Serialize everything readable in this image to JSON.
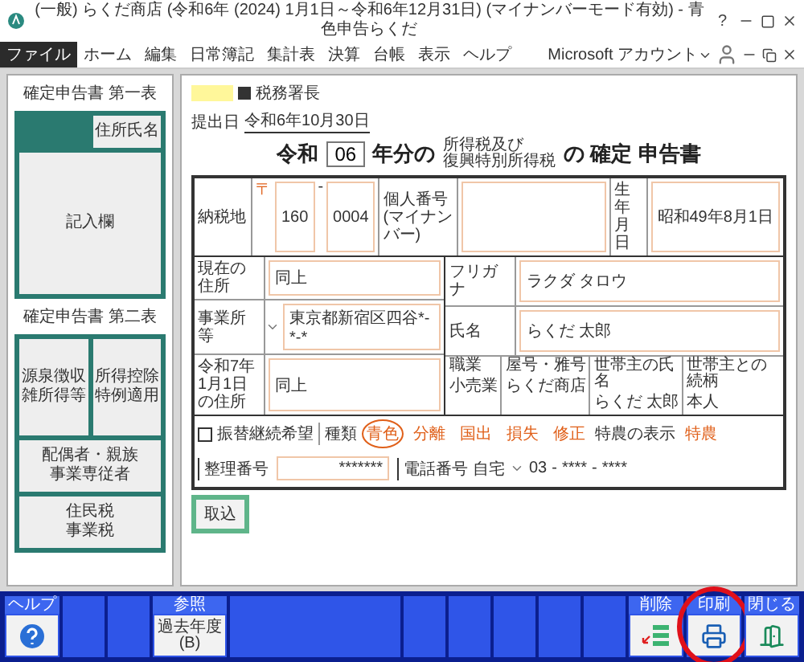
{
  "window": {
    "title": "(一般) らくだ商店 (令和6年 (2024) 1月1日～令和6年12月31日) (マイナンバーモード有効) - 青色申告らくだ",
    "help": "?"
  },
  "menu": {
    "items": [
      {
        "label": "ファイル",
        "selected": true
      },
      {
        "label": "ホーム",
        "selected": false
      },
      {
        "label": "編集",
        "selected": false
      },
      {
        "label": "日常簿記",
        "selected": false
      },
      {
        "label": "集計表",
        "selected": false
      },
      {
        "label": "決算",
        "selected": false
      },
      {
        "label": "台帳",
        "selected": false
      },
      {
        "label": "表示",
        "selected": false
      },
      {
        "label": "ヘルプ",
        "selected": false
      }
    ],
    "account": "Microsoft アカウント"
  },
  "sidebar": {
    "sections": [
      {
        "title": "確定申告書 第一表",
        "buttons": [
          {
            "kind": "tab",
            "lines": [
              "住所氏名"
            ]
          },
          {
            "kind": "large",
            "lines": [
              "記入欄"
            ]
          }
        ]
      },
      {
        "title": "確定申告書 第二表",
        "buttons": [
          {
            "kind": "half",
            "lines": [
              "源泉徴収",
              "雑所得等"
            ]
          },
          {
            "kind": "half",
            "lines": [
              "所得控除",
              "特例適用"
            ]
          },
          {
            "kind": "full",
            "lines": [
              "配偶者・親族",
              "事業専従者"
            ]
          },
          {
            "kind": "full",
            "lines": [
              "住民税",
              "事業税"
            ]
          }
        ]
      }
    ]
  },
  "form": {
    "office_suffix": "税務署長",
    "submit_label": "提出日",
    "submit_date": "令和6年10月30日",
    "title": {
      "era": "令和",
      "year": "06",
      "suffix": "年分の",
      "tax_lines": [
        "所得税及び",
        "復興特別所得税"
      ],
      "form_name": "の 確定 申告書"
    },
    "address_label": "納税地",
    "postal_mark": "〒",
    "postal_1": "160",
    "postal_sep": "-",
    "postal_2": "0004",
    "mynumber_label": "個人番号(マイナンバー)",
    "birth_label": "生年月日",
    "birth": "昭和49年8月1日",
    "left_rows": [
      {
        "label": "現在の住所",
        "value": "同上",
        "dropdown": false
      },
      {
        "label": "事業所等",
        "value": "東京都新宿区四谷*-*-*",
        "dropdown": true
      },
      {
        "label": "令和7年1月1日の住所",
        "value": "同上",
        "dropdown": false
      }
    ],
    "furigana_label": "フリガナ",
    "furigana": "ラクダ タロウ",
    "name_label": "氏名",
    "name": "らくだ 太郎",
    "info": [
      {
        "label": "職業",
        "value": "小売業"
      },
      {
        "label": "屋号・雅号",
        "value": "らくだ商店"
      },
      {
        "label": "世帯主の氏名",
        "value": "らくだ 太郎"
      },
      {
        "label": "世帯主との続柄",
        "value": "本人"
      }
    ],
    "transfer": {
      "label": "振替継続希望",
      "checked": false
    },
    "type_label": "種類",
    "types": [
      {
        "label": "青色",
        "selected": true
      },
      {
        "label": "分離",
        "selected": false
      },
      {
        "label": "国出",
        "selected": false
      },
      {
        "label": "損失",
        "selected": false
      },
      {
        "label": "修正",
        "selected": false
      }
    ],
    "special_label": "特農の表示",
    "special": "特農",
    "ref_label": "整理番号",
    "ref": "*******",
    "phone_label": "電話番号",
    "phone_kind": "自宅",
    "phone": [
      "03",
      "-",
      "****",
      "-",
      "****"
    ],
    "import_button": "取込"
  },
  "function_bar": [
    {
      "kind": "help",
      "label": "ヘルプ",
      "highlighted": false
    },
    {
      "kind": "empty"
    },
    {
      "kind": "empty"
    },
    {
      "kind": "text",
      "label": "参照",
      "button": "過去年度(B)"
    },
    {
      "kind": "wide"
    },
    {
      "kind": "empty"
    },
    {
      "kind": "empty"
    },
    {
      "kind": "empty"
    },
    {
      "kind": "empty"
    },
    {
      "kind": "empty"
    },
    {
      "kind": "delete",
      "label": "削除",
      "highlighted": false
    },
    {
      "kind": "print",
      "label": "印刷",
      "highlighted": true
    },
    {
      "kind": "close",
      "label": "閉じる",
      "highlighted": false
    }
  ]
}
